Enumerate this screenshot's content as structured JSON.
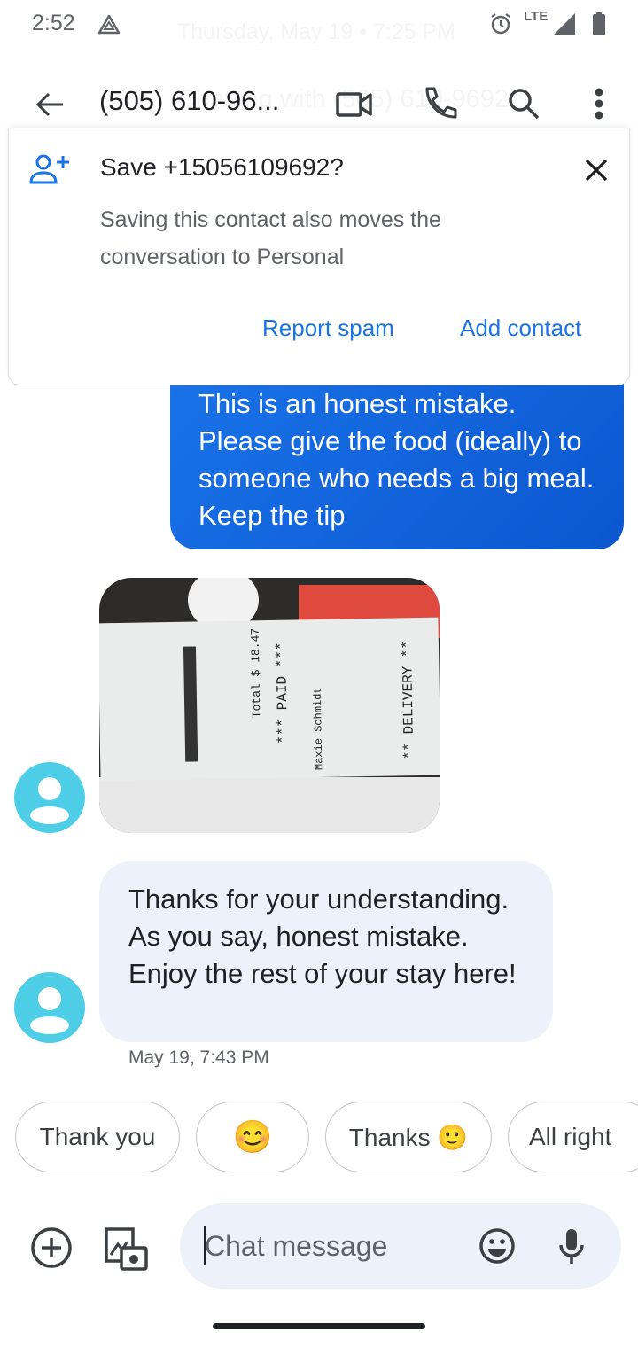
{
  "status_bar": {
    "time": "2:52",
    "network": "LTE",
    "ghost_date": "Thursday, May 19 • 7:25 PM"
  },
  "toolbar": {
    "title": "(505) 610-96...",
    "ghost_subtitle": "Chatting with (505) 610-9692"
  },
  "save_card": {
    "title": "Save +15056109692?",
    "subtitle": "Saving this contact also moves the conversation to Personal",
    "report_spam": "Report spam",
    "add_contact": "Add contact"
  },
  "messages": [
    {
      "direction": "outgoing",
      "text": "This is an honest mistake. Please give the food (ideally) to someone who needs a big meal. Keep the tip"
    },
    {
      "direction": "incoming",
      "type": "image",
      "receipt": {
        "paid": "*** PAID ***",
        "delivery": "** DELIVERY **",
        "total": "Total $ 18.47",
        "name": "Maxie Schmidt"
      }
    },
    {
      "direction": "incoming",
      "text": "Thanks for your understanding. As you say, honest mistake. Enjoy the rest of your stay here!",
      "timestamp": "May 19, 7:43 PM"
    }
  ],
  "smart_replies": [
    "Thank you",
    "😊",
    "Thanks 🙂",
    "All right"
  ],
  "compose": {
    "placeholder": "Chat message"
  },
  "colors": {
    "accent": "#1a73e8",
    "avatar": "#4ecde6",
    "incoming_bubble": "#edf2fa"
  }
}
